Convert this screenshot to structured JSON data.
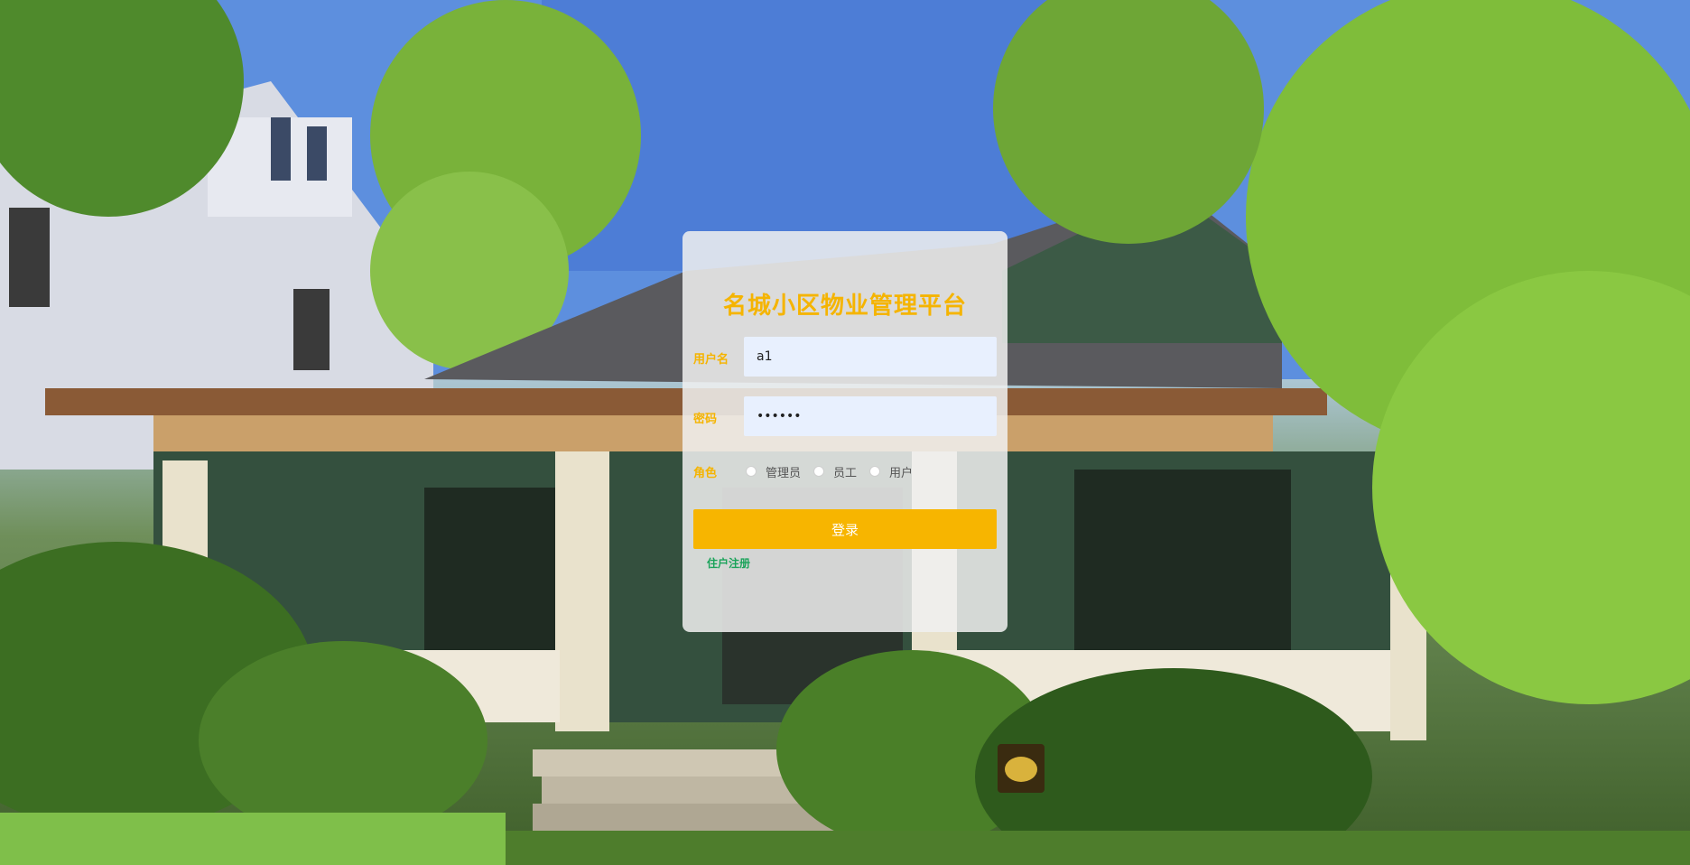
{
  "background": {
    "description_icon": "house-photo-background"
  },
  "login": {
    "title": "名城小区物业管理平台",
    "username_label": "用户名",
    "username_value": "a1",
    "password_label": "密码",
    "password_value": "123456",
    "role_label": "角色",
    "roles": [
      "管理员",
      "员工",
      "用户"
    ],
    "login_button": "登录",
    "register_link": "住户注册"
  },
  "colors": {
    "accent": "#f7b500",
    "link": "#1aa35a",
    "input_bg": "#e8f0fe"
  }
}
